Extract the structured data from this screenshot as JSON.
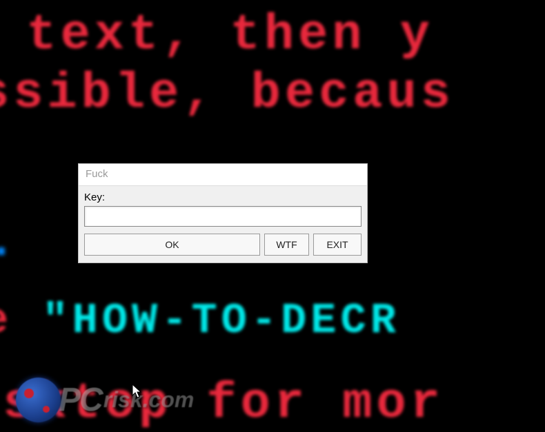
{
  "background": {
    "line1": "s text, then y",
    "line2": "ssible, becaus",
    "line3_prefix": "e ",
    "line3": "\"HOW-TO-DECR",
    "line4": "esktop for mor"
  },
  "dialog": {
    "title": "Fuck",
    "field_label": "Key:",
    "field_value": "",
    "field_placeholder": "",
    "buttons": {
      "ok": "OK",
      "wtf": "WTF",
      "exit": "EXIT"
    }
  },
  "watermark": {
    "brand": "PC",
    "domain": "risk.com"
  }
}
